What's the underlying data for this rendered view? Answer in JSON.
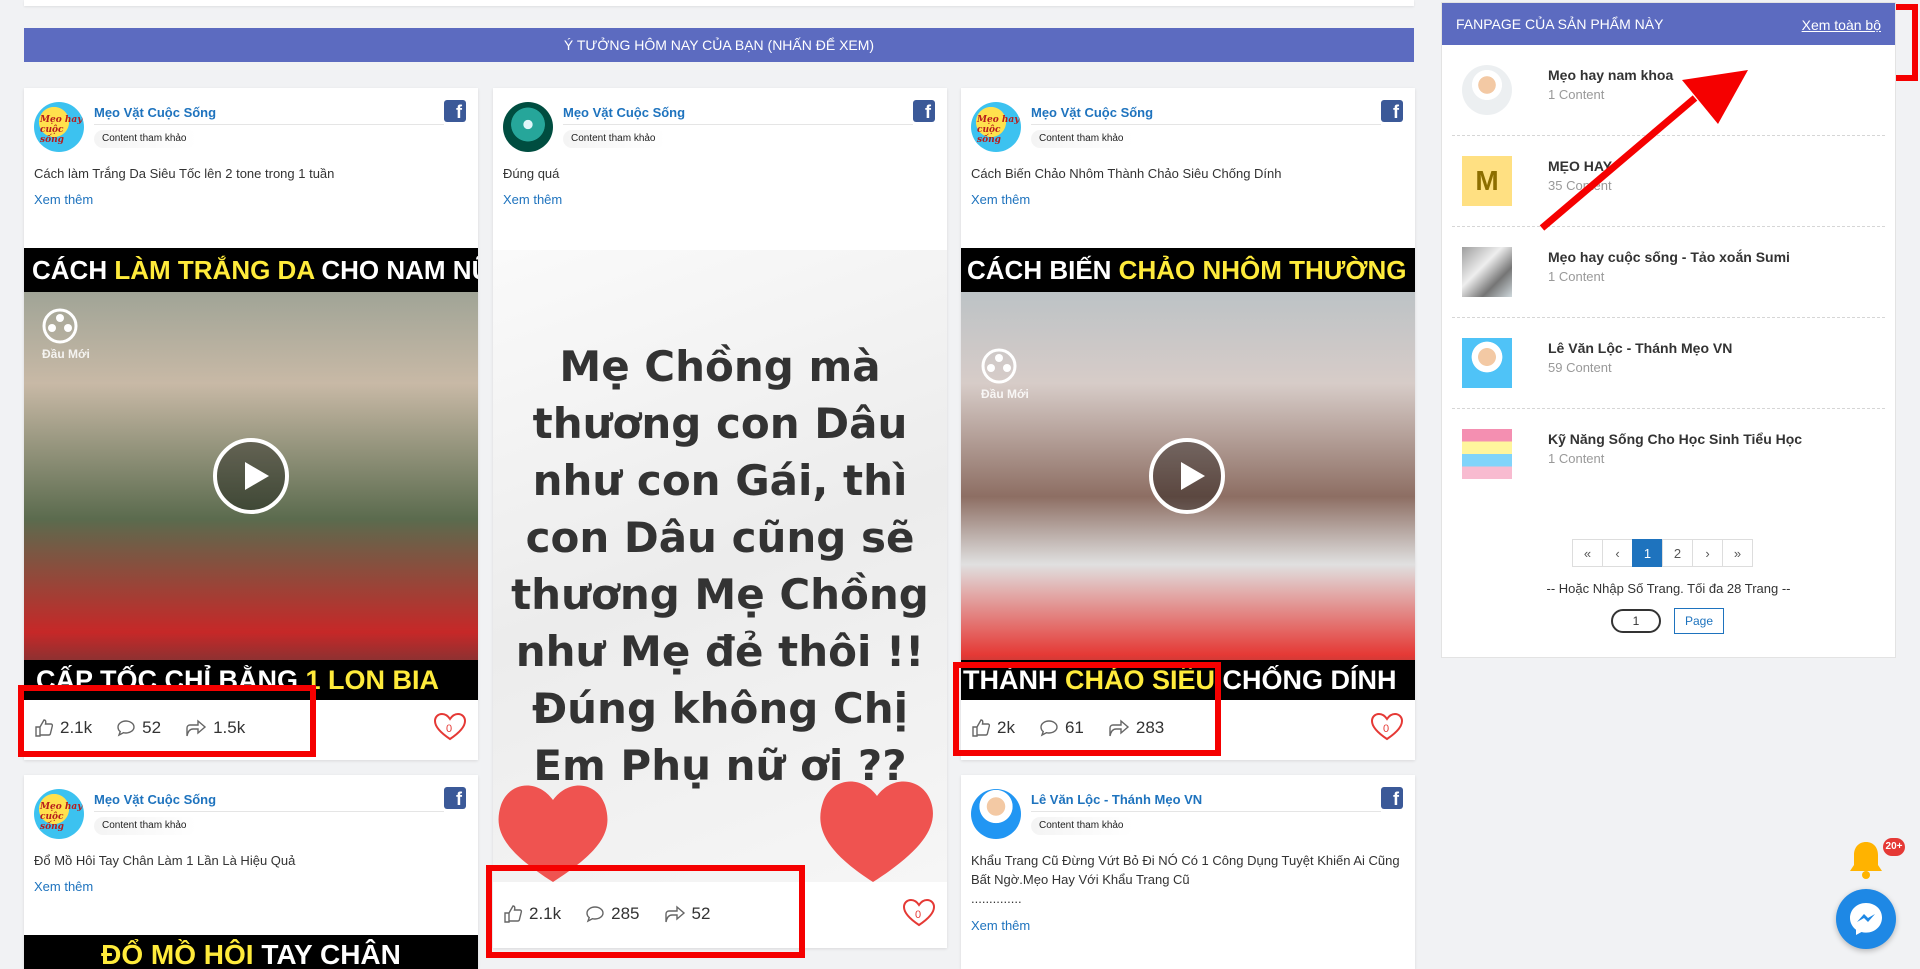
{
  "banner": {
    "title": "Ý TƯỞNG HÔM NAY CỦA BẠN (NHẤN ĐỂ XEM)"
  },
  "common": {
    "content_badge": "Content tham khảo",
    "see_more": "Xem thêm"
  },
  "cards": [
    {
      "page_name": "Mẹo Vặt Cuộc Sống",
      "avatar_text": "Mẹo hay cuộc sống",
      "text": "Cách làm Trắng Da Siêu Tốc lên 2 tone trong 1 tuần",
      "video_top": [
        "CÁCH ",
        "LÀM TRẮNG DA",
        " CHO NAM NỮ"
      ],
      "video_bottom": [
        "CẤP TỐC CHỈ BẰNG ",
        "1 LON BIA"
      ],
      "watermark": "Đầu Mới",
      "likes": "2.1k",
      "comments": "52",
      "shares": "1.5k",
      "hearts": "0"
    },
    {
      "page_name": "Mẹo Vặt Cuộc Sống",
      "text": "Đúng quá",
      "image_text": "Mẹ Chồng mà thương con Dâu như con Gái, thì con Dâu cũng sẽ thương Mẹ Chồng như Mẹ đẻ thôi !! Đúng không Chị Em Phụ nữ ơi ??",
      "likes": "2.1k",
      "comments": "285",
      "shares": "52",
      "hearts": "0"
    },
    {
      "page_name": "Mẹo Vặt Cuộc Sống",
      "avatar_text": "Mẹo hay cuộc sống",
      "text": "Cách Biến Chảo Nhôm Thành Chảo Siêu Chống Dính",
      "video_top": [
        "CÁCH BIẾN ",
        "CHẢO NHÔM THƯỜNG",
        ""
      ],
      "video_bottom": [
        "THÀNH ",
        "CHẢO SIÊU",
        " CHỐNG DÍNH"
      ],
      "watermark": "Đầu Mới",
      "likes": "2k",
      "comments": "61",
      "shares": "283",
      "hearts": "0"
    },
    {
      "page_name": "Mẹo Vặt Cuộc Sống",
      "avatar_text": "Mẹo hay cuộc sống",
      "text": "Đổ Mồ Hôi Tay Chân Làm 1 Lần Là Hiệu Quả",
      "video_top": [
        "",
        "ĐỔ MỒ HÔI",
        " TAY CHÂN"
      ]
    },
    {
      "page_name": "Lê Văn Lộc - Thánh Mẹo VN",
      "text": "Khẩu Trang Cũ Đừng Vứt Bỏ Đi NÓ Có 1 Công Dụng Tuyệt Khiến Ai Cũng Bất Ngờ.Mẹo Hay Với Khẩu Trang Cũ",
      "text2": ".............."
    }
  ],
  "sidebar": {
    "title": "FANPAGE CỦA SẢN PHẨM NÀY",
    "see_all": "Xem toàn bộ",
    "items": [
      {
        "name": "Mẹo hay nam khoa",
        "count": "1 Content"
      },
      {
        "name": "MẸO HAY",
        "count": "35 Content",
        "thumb_letter": "M"
      },
      {
        "name": "Mẹo hay cuộc sống - Tảo xoắn Sumi",
        "count": "1 Content"
      },
      {
        "name": "Lê Văn Lộc - Thánh Mẹo VN",
        "count": "59 Content"
      },
      {
        "name": "Kỹ Năng Sống Cho Học Sinh Tiểu Học",
        "count": "1 Content"
      }
    ],
    "pagination": {
      "first": "«",
      "prev": "‹",
      "pages": [
        "1",
        "2"
      ],
      "next": "›",
      "last": "»",
      "hint": "-- Hoặc Nhập Số Trang. Tối đa 28 Trang --",
      "input_value": "1",
      "go_label": "Page"
    }
  },
  "notification": {
    "badge": "20+"
  },
  "colors": {
    "banner": "#5c6bc0",
    "link": "#1e73be",
    "highlight": "#f50000",
    "accent_yellow": "#ffeb3b"
  }
}
